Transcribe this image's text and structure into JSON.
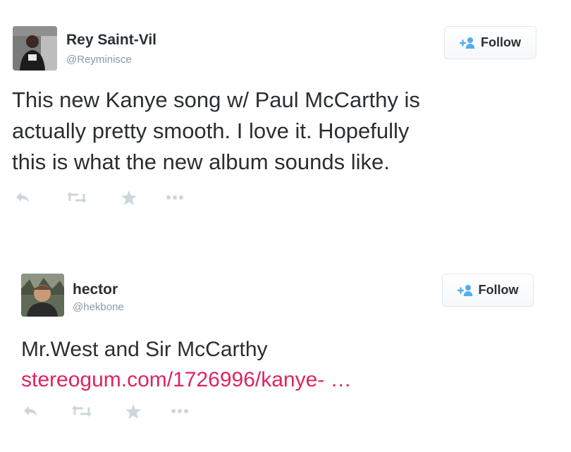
{
  "tweets": [
    {
      "name": "Rey Saint-Vil",
      "handle": "@Reyminisce",
      "follow_label": "Follow",
      "text_lines": [
        "This new Kanye song w/ Paul McCarthy is",
        "actually pretty smooth. I love it. Hopefully",
        "this is what the new album sounds like."
      ],
      "actions": [
        "reply-icon",
        "retweet-icon",
        "favorite-icon",
        "more-icon"
      ]
    },
    {
      "name": "hector",
      "handle": "@hekbone",
      "follow_label": "Follow",
      "text": "Mr.West and Sir McCarthy",
      "link": "stereogum.com/1726996/kanye- …",
      "actions": [
        "reply-icon",
        "retweet-icon",
        "favorite-icon",
        "more-icon"
      ]
    }
  ],
  "colors": {
    "text": "#292f33",
    "secondary": "#8899a6",
    "link": "#e0245e",
    "follow_icon": "#55acee",
    "action_icon": "#ccd6dd"
  }
}
